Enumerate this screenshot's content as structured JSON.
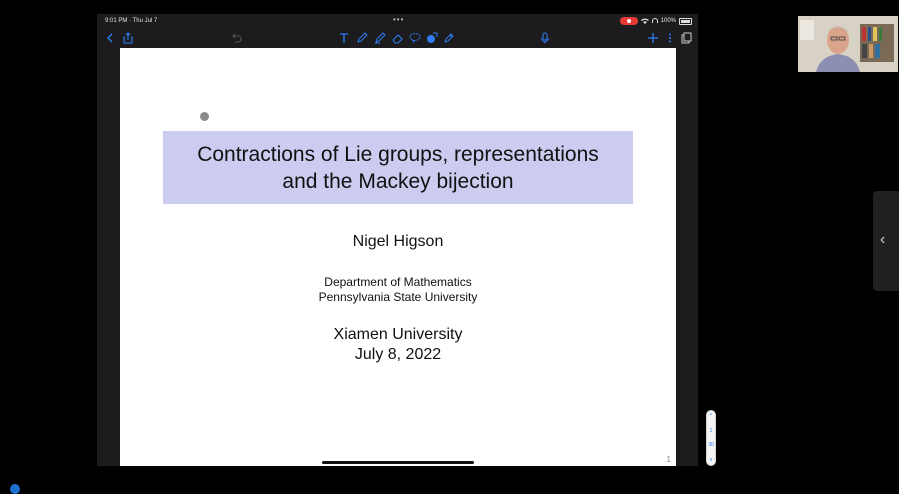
{
  "status_bar": {
    "time": "9:01 PM · Thu Jul 7",
    "dots": "•••",
    "battery": "100%"
  },
  "toolbar": {
    "accent_color": "#2f7df6",
    "left_icons": [
      "back-icon",
      "share-icon",
      "undo-icon"
    ],
    "center_icons": [
      "text-tool-icon",
      "pen-icon",
      "highlighter-icon",
      "eraser-icon",
      "lasso-icon",
      "shapes-icon",
      "pencil-icon"
    ],
    "right_icons": [
      "microphone-icon",
      "add-icon",
      "more-icon",
      "pages-icon"
    ]
  },
  "slide": {
    "title_line1": "Contractions of Lie groups, representations",
    "title_line2": "and the Mackey bijection",
    "title_bg_color": "#ccccf0",
    "author": "Nigel Higson",
    "department": "Department of Mathematics",
    "university": "Pennsylvania State University",
    "venue": "Xiamen University",
    "date": "July 8, 2022",
    "page_number": "1"
  },
  "scrubber": {
    "labels": [
      "^",
      "1",
      "30",
      "v"
    ]
  },
  "side_panel": {
    "chevron": "‹"
  }
}
